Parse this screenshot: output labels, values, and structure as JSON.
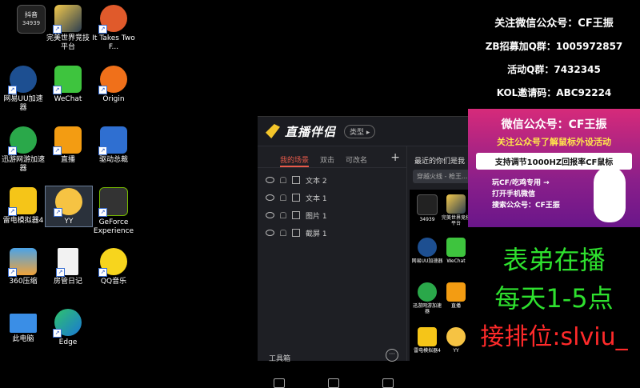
{
  "desktop": {
    "icons": [
      {
        "label": "",
        "badge": "抖音",
        "sub": "34939"
      },
      {
        "label": "完美世界竞技平台"
      },
      {
        "label": "It Takes Two F..."
      },
      {
        "label": "网易UU加速器"
      },
      {
        "label": "WeChat"
      },
      {
        "label": "Origin"
      },
      {
        "label": "迅游网游加速器"
      },
      {
        "label": "直播"
      },
      {
        "label": "驱动总裁"
      },
      {
        "label": "雷电模拟器4"
      },
      {
        "label": "YY"
      },
      {
        "label": "GeForce Experience"
      },
      {
        "label": "360压缩"
      },
      {
        "label": "房管日记"
      },
      {
        "label": "QQ音乐"
      },
      {
        "label": "此电脑"
      },
      {
        "label": "Edge"
      }
    ]
  },
  "app": {
    "name": "直播伴侣",
    "type_pill": "类型 ▸",
    "tabs": [
      "我的场景",
      "双击",
      "可改名"
    ],
    "add_label": "+",
    "layers": [
      {
        "label": "文本 2"
      },
      {
        "label": "文本 1"
      },
      {
        "label": "图片 1"
      },
      {
        "label": "截屏 1"
      }
    ],
    "toolbox_label": "工具箱",
    "more_label": "···",
    "recent_label": "最近的你们是我",
    "chip_label": "穿越火线 - 枪王..."
  },
  "overlay": {
    "line1": "关注微信公众号：CF王振",
    "line2": "ZB招募加Q群：1005972857",
    "line3": "活动Q群：7432345",
    "line4": "KOL邀请码：ABC92224",
    "ad_title": "微信公众号：CF王振",
    "ad_sub": "关注公众号了解鼠标外设活动",
    "ad_box": "支持调节1000HZ回报率CF鼠标",
    "ad_text1": "玩CF/吃鸡专用 →",
    "ad_text2": "打开手机微信",
    "ad_text3": "搜索公众号：CF王振",
    "big1": "表弟在播",
    "big2": "每天1-5点",
    "big3": "接排位:slviu_"
  }
}
